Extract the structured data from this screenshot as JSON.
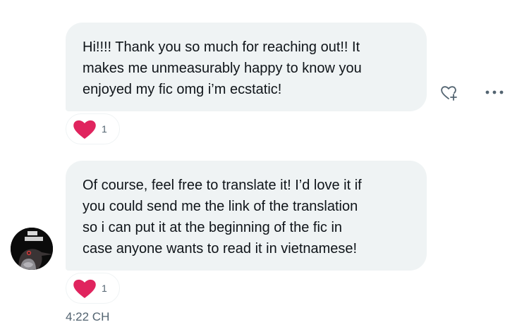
{
  "messages": [
    {
      "lines": [
        "Hi!!!! Thank you so much for reaching out!! It",
        "makes me unmeasurably happy to know you",
        "enjoyed my fic omg i’m ecstatic!"
      ],
      "reaction": {
        "icon": "heart-icon",
        "count": "1"
      }
    },
    {
      "lines": [
        "Of course, feel free to translate it! I’d love it if",
        "you could send me the link of the translation",
        "so i can put it at the beginning of the fic in",
        "case anyone wants to read it in vietnamese!"
      ],
      "reaction": {
        "icon": "heart-icon",
        "count": "1"
      }
    }
  ],
  "timestamp": "4:22 CH",
  "colors": {
    "bubble": "#eff3f4",
    "heart": "#e0245e",
    "muted": "#536471"
  },
  "icons": {
    "react": "heart-add-icon",
    "more": "more-horizontal-icon"
  }
}
